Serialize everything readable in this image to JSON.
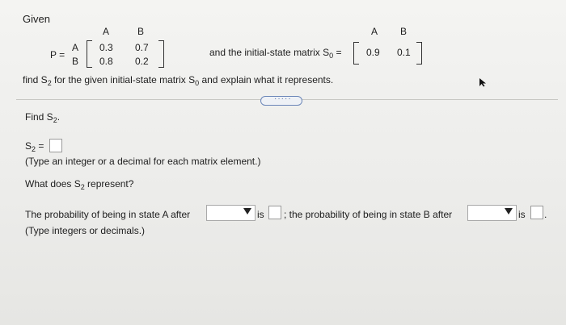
{
  "given_label": "Given",
  "matrix_p": {
    "label": "P =",
    "col_headers": [
      "A",
      "B"
    ],
    "row_headers": [
      "A",
      "B"
    ],
    "rows": [
      [
        "0.3",
        "0.7"
      ],
      [
        "0.8",
        "0.2"
      ]
    ]
  },
  "initial_text": "and the initial-state matrix S",
  "initial_sub": "0",
  "initial_eq": "=",
  "matrix_s0": {
    "col_headers": [
      "A",
      "B"
    ],
    "row": [
      "0.9",
      "0.1"
    ]
  },
  "instruction": {
    "p1": "find S",
    "s1": "2",
    "p2": " for the given initial-state matrix S",
    "s2": "0",
    "p3": " and explain what it represents."
  },
  "collapse_dots": "·····",
  "find": {
    "prefix": "Find S",
    "sub": "2",
    "suffix": "."
  },
  "s2_answer": {
    "prefix": "S",
    "sub": "2",
    "eq": " ="
  },
  "hint1": "(Type an integer or a decimal for each matrix element.)",
  "question2": {
    "prefix": "What does S",
    "sub": "2",
    "suffix": " represent?"
  },
  "sentence": {
    "part1": "The probability of being in state A after",
    "is1": "is",
    "part2": "; the probability of being in state B after",
    "is2": "is",
    "end": "."
  },
  "hint2": "(Type integers or decimals.)"
}
